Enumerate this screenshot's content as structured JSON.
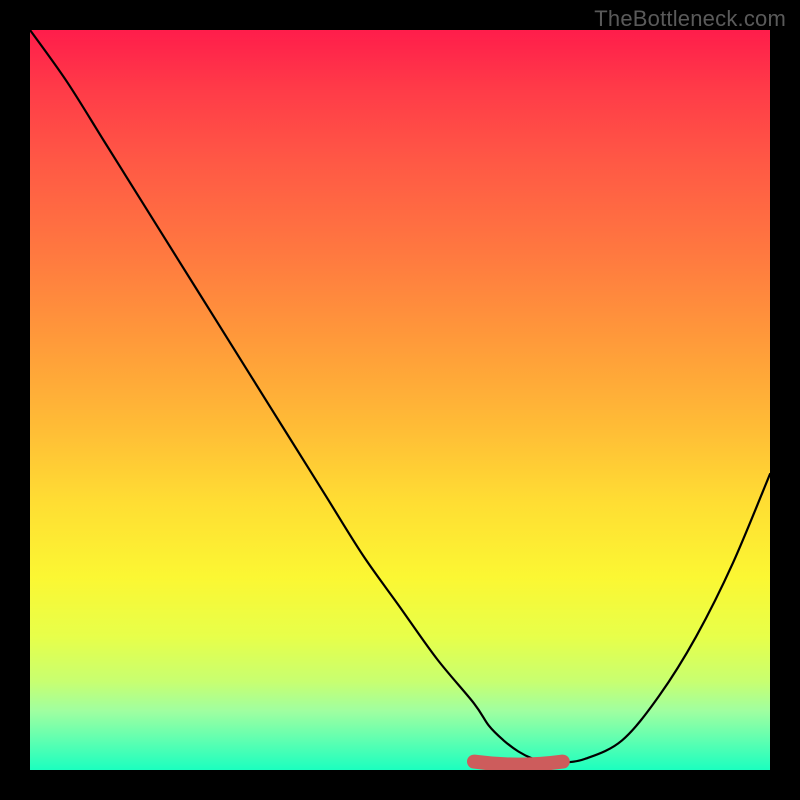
{
  "watermark": "TheBottleneck.com",
  "colors": {
    "frame": "#000000",
    "curve": "#000000",
    "marker": "#cd5c5c",
    "gradient_top": "#ff1d4b",
    "gradient_bottom": "#1bffbf"
  },
  "chart_data": {
    "type": "line",
    "title": "",
    "xlabel": "",
    "ylabel": "",
    "xlim": [
      0,
      100
    ],
    "ylim": [
      0,
      100
    ],
    "x": [
      0,
      5,
      10,
      15,
      20,
      25,
      30,
      35,
      40,
      45,
      50,
      55,
      60,
      62,
      64,
      66,
      68,
      70,
      72,
      75,
      80,
      85,
      90,
      95,
      100
    ],
    "values": [
      100,
      93,
      85,
      77,
      69,
      61,
      53,
      45,
      37,
      29,
      22,
      15,
      9,
      6,
      4,
      2.5,
      1.5,
      1,
      1,
      1.5,
      4,
      10,
      18,
      28,
      40
    ],
    "marker_segment": {
      "x_from": 60,
      "x_to": 72,
      "y": 1
    },
    "notes": "Black curve descends steeply from upper-left, flattens near x≈65–72 at the bottom, then rises toward the right. Salmon thick segment highlights the flat minimum region near the bottom."
  }
}
